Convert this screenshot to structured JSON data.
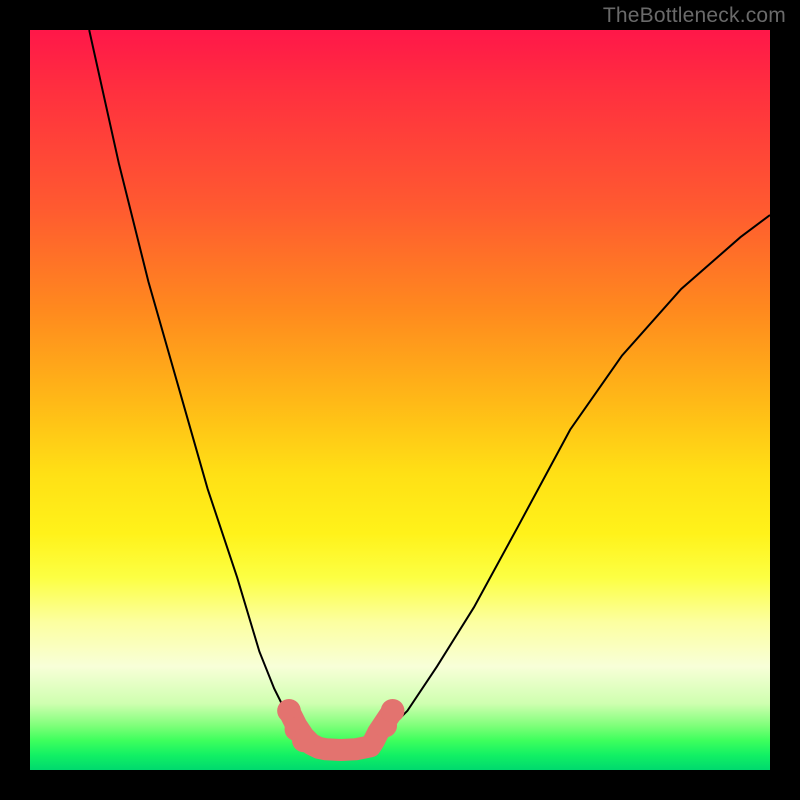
{
  "watermark": "TheBottleneck.com",
  "chart_data": {
    "type": "line",
    "title": "",
    "xlabel": "",
    "ylabel": "",
    "xlim": [
      0,
      100
    ],
    "ylim": [
      0,
      100
    ],
    "grid": false,
    "legend": false,
    "series": [
      {
        "name": "left-curve",
        "x": [
          8,
          12,
          16,
          20,
          24,
          28,
          31,
          33,
          35,
          36.5,
          38
        ],
        "y": [
          100,
          82,
          66,
          52,
          38,
          26,
          16,
          11,
          7,
          5,
          3.5
        ],
        "color": "#000000"
      },
      {
        "name": "right-curve",
        "x": [
          46,
          48,
          51,
          55,
          60,
          66,
          73,
          80,
          88,
          96,
          100
        ],
        "y": [
          3.5,
          5,
          8,
          14,
          22,
          33,
          46,
          56,
          65,
          72,
          75
        ],
        "color": "#000000"
      },
      {
        "name": "bottom-segment",
        "x": [
          35,
          36,
          37,
          38,
          39,
          40,
          42,
          44,
          45,
          46,
          46.5,
          47,
          48,
          49
        ],
        "y": [
          8,
          6,
          4.5,
          3.5,
          3,
          2.8,
          2.7,
          2.8,
          3,
          3.2,
          4,
          5,
          6.5,
          8
        ],
        "color": "#e3736f"
      }
    ],
    "highlight_points": [
      {
        "x": 35,
        "y": 8
      },
      {
        "x": 36,
        "y": 5.5
      },
      {
        "x": 37,
        "y": 4
      },
      {
        "x": 48,
        "y": 6
      },
      {
        "x": 49,
        "y": 8
      }
    ]
  }
}
